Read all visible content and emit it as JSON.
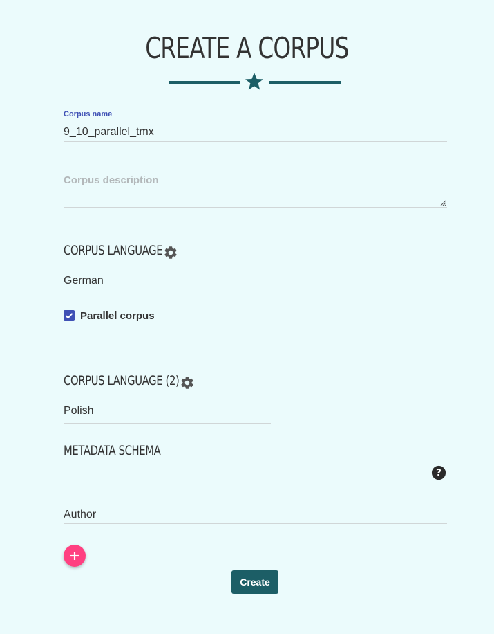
{
  "page": {
    "title": "CREATE A CORPUS"
  },
  "corpus_name": {
    "label": "Corpus name",
    "value": "9_10_parallel_tmx"
  },
  "corpus_description": {
    "placeholder": "Corpus description",
    "value": ""
  },
  "language_1": {
    "heading": "CORPUS LANGUAGE",
    "selected": "German"
  },
  "parallel": {
    "label": "Parallel corpus",
    "checked": true
  },
  "language_2": {
    "heading": "CORPUS LANGUAGE (2)",
    "selected": "Polish"
  },
  "metadata": {
    "heading": "METADATA SCHEMA",
    "field_value": "Author"
  },
  "actions": {
    "create_label": "Create"
  },
  "colors": {
    "background": "#ebfbfc",
    "primary": "#1c5e66",
    "accent_pink": "#ff4081",
    "focus_blue": "#3f51b5",
    "text": "#333333"
  },
  "icons": {
    "divider": "star-icon",
    "language_settings": "gear-icon",
    "checkbox": "checkmark-icon",
    "help": "question-circle-icon",
    "add": "plus-icon"
  }
}
